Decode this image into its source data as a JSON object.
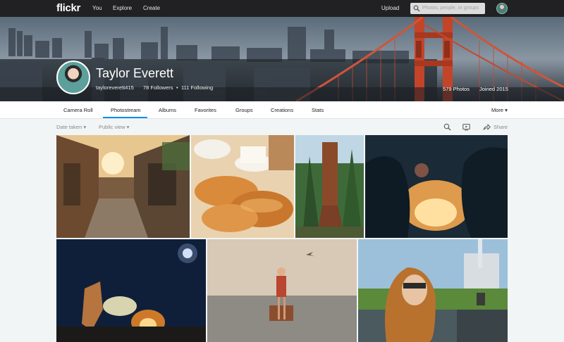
{
  "topnav": {
    "logo": "flickr",
    "links": [
      "You",
      "Explore",
      "Create"
    ],
    "upload": "Upload",
    "search_placeholder": "Photos, people, or groups"
  },
  "profile": {
    "name": "Taylor Everett",
    "handle": "tayloreverett415",
    "followers": "78 Followers",
    "separator": "•",
    "following": "111 Following",
    "photos": "579 Photos",
    "joined": "Joined 2015"
  },
  "subnav": {
    "tabs": [
      "Camera Roll",
      "Photostream",
      "Albums",
      "Favorites",
      "Groups",
      "Creations",
      "Stats"
    ],
    "active": "Photostream",
    "more": "More ▾"
  },
  "toolbar": {
    "date_filter": "Date taken ▾",
    "view_filter": "Public view ▾",
    "share": "Share"
  },
  "icons": {
    "search": "search-icon",
    "slideshow": "slideshow-icon",
    "share": "share-arrow-icon"
  },
  "colors": {
    "nav_bg": "#212124",
    "accent": "#0f90ec",
    "page_bg": "#f2f5f6"
  }
}
